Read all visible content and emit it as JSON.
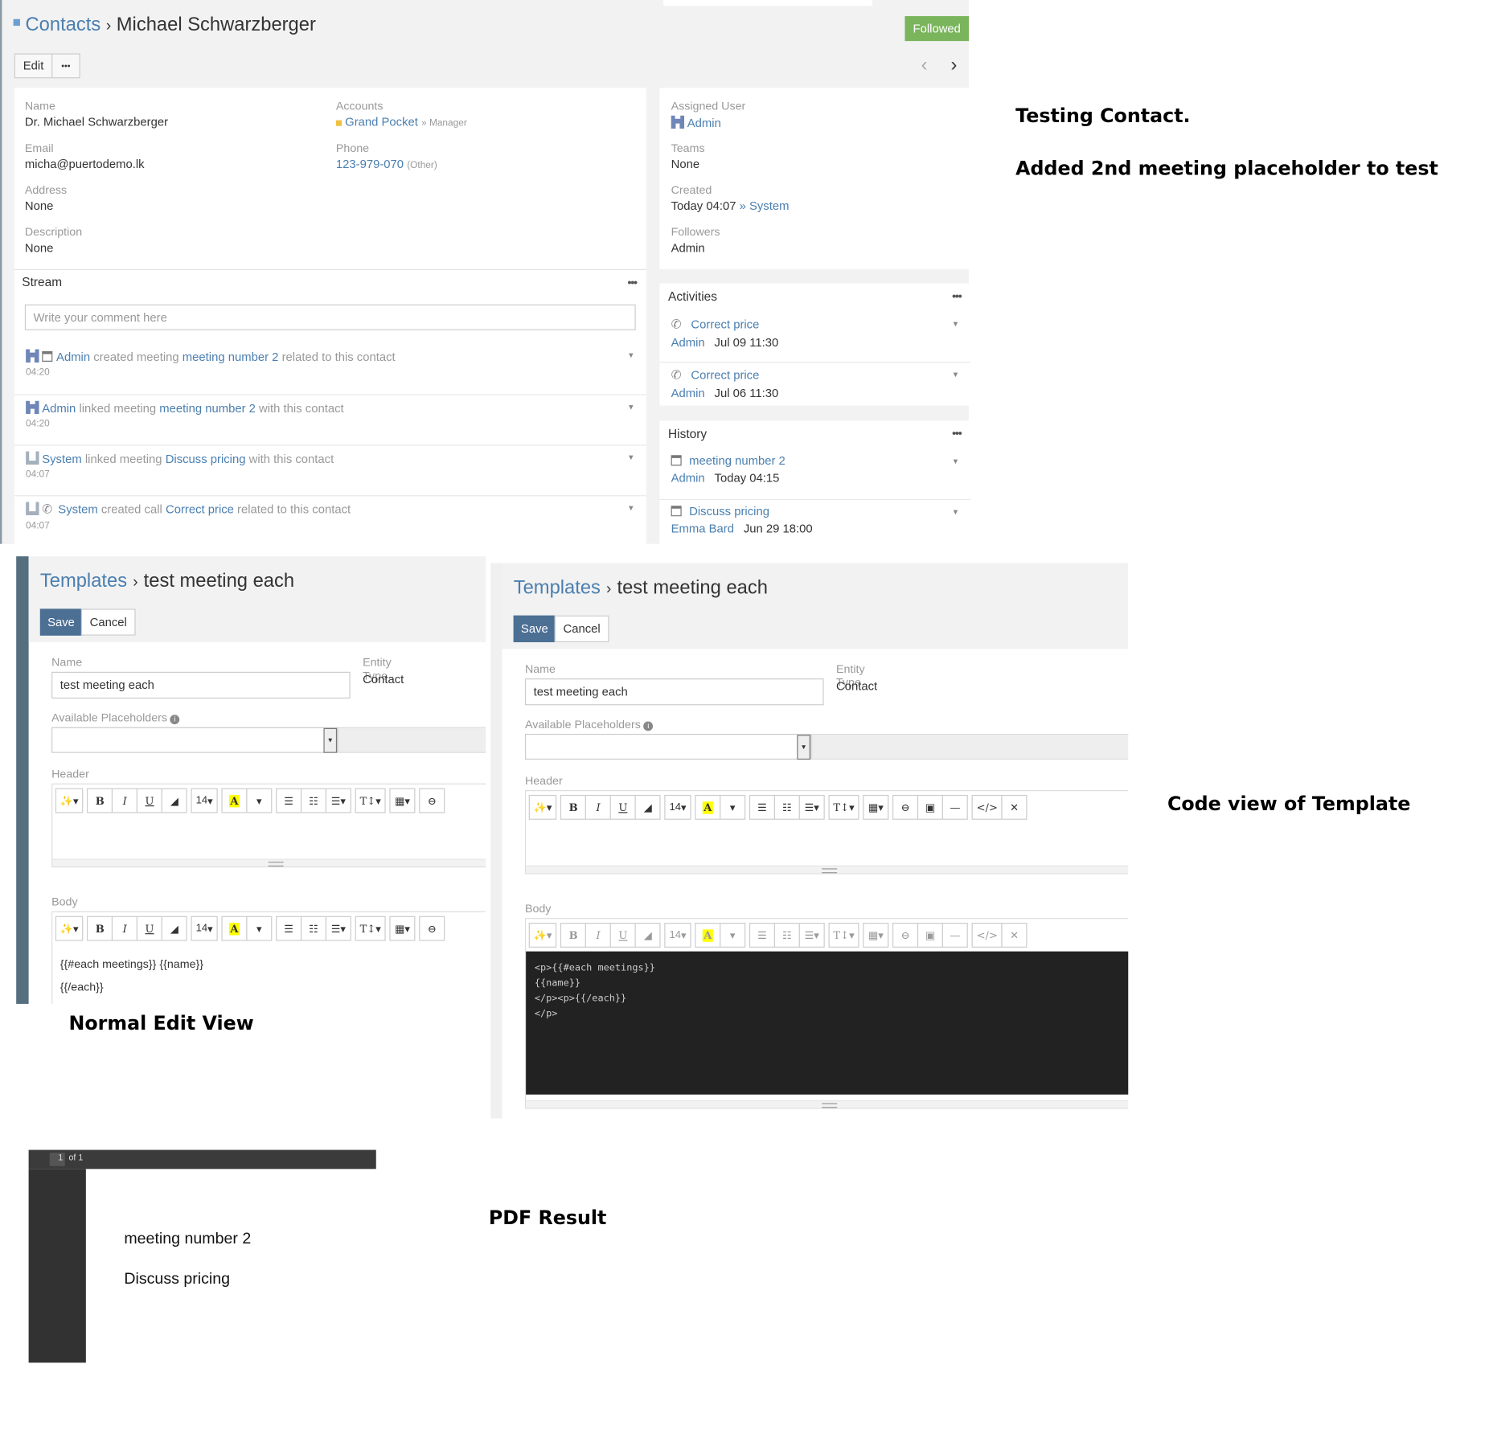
{
  "contact": {
    "breadcrumb": {
      "parent": "Contacts",
      "sep": "›",
      "current": "Michael Schwarzberger"
    },
    "followed_label": "Followed",
    "edit_label": "Edit",
    "more_label": "•••",
    "prev_icon": "chevron-left-icon",
    "next_icon": "chevron-right-icon",
    "fields": {
      "name_label": "Name",
      "name": "Dr. Michael Schwarzberger",
      "accounts_label": "Accounts",
      "account": "Grand Pocket",
      "account_role": "» Manager",
      "email_label": "Email",
      "email": "micha@puertodemo.lk",
      "phone_label": "Phone",
      "phone": "123-979-070",
      "phone_type": "(Other)",
      "address_label": "Address",
      "address": "None",
      "description_label": "Description",
      "description": "None"
    },
    "side": {
      "assigned_label": "Assigned User",
      "assigned": "Admin",
      "teams_label": "Teams",
      "teams": "None",
      "created_label": "Created",
      "created": "Today 04:07",
      "created_by": "» System",
      "followers_label": "Followers",
      "followers": "Admin"
    },
    "stream": {
      "title": "Stream",
      "comment_placeholder": "Write your comment here",
      "items": [
        {
          "user": "Admin",
          "pre": "created meeting",
          "target": "meeting number 2",
          "post": "related to this contact",
          "time": "04:20"
        },
        {
          "user": "Admin",
          "pre": "linked meeting",
          "target": "meeting number 2",
          "post": "with this contact",
          "time": "04:20"
        },
        {
          "user": "System",
          "pre": "linked meeting",
          "target": "Discuss pricing",
          "post": "with this contact",
          "time": "04:07"
        },
        {
          "user": "System",
          "pre": "created call",
          "target": "Correct price",
          "post": "related to this contact",
          "time": "04:07"
        }
      ]
    },
    "activities": {
      "title": "Activities",
      "items": [
        {
          "name": "Correct price",
          "user": "Admin",
          "date": "Jul 09 11:30"
        },
        {
          "name": "Correct price",
          "user": "Admin",
          "date": "Jul 06 11:30"
        }
      ]
    },
    "history": {
      "title": "History",
      "items": [
        {
          "name": "meeting number 2",
          "user": "Admin",
          "date": "Today 04:15"
        },
        {
          "name": "Discuss pricing",
          "user": "Emma Bard",
          "date": "Jun 29 18:00"
        }
      ]
    }
  },
  "template": {
    "breadcrumb": {
      "parent": "Templates",
      "sep": "›",
      "current": "test meeting each"
    },
    "save_label": "Save",
    "cancel_label": "Cancel",
    "name_label": "Name *",
    "name_value": "test meeting each",
    "entity_label": "Entity Type",
    "entity_value": "Contact",
    "placeholders_label": "Available Placeholders",
    "header_label": "Header",
    "body_label": "Body",
    "font_size": "14",
    "body_lines": [
      "{{#each meetings}} {{name}}",
      "{{/each}}"
    ],
    "code_lines": [
      "<p>{{#each meetings}}",
      "{{name}}",
      "</p><p>{{/each}}",
      "</p>"
    ]
  },
  "pdf": {
    "page": "1",
    "of": "of 1",
    "lines": [
      "meeting number 2",
      "Discuss pricing"
    ]
  },
  "notes": {
    "testing": "Testing Contact.",
    "added": "Added 2nd meeting placeholder to test",
    "code_view": "Code view of Template",
    "normal_view": "Normal Edit View",
    "pdf_result": "PDF Result"
  },
  "colors": {
    "accent": "#4a7fb0",
    "followed": "#7ab55c",
    "save": "#4c6f94",
    "code_bg": "#222222"
  }
}
